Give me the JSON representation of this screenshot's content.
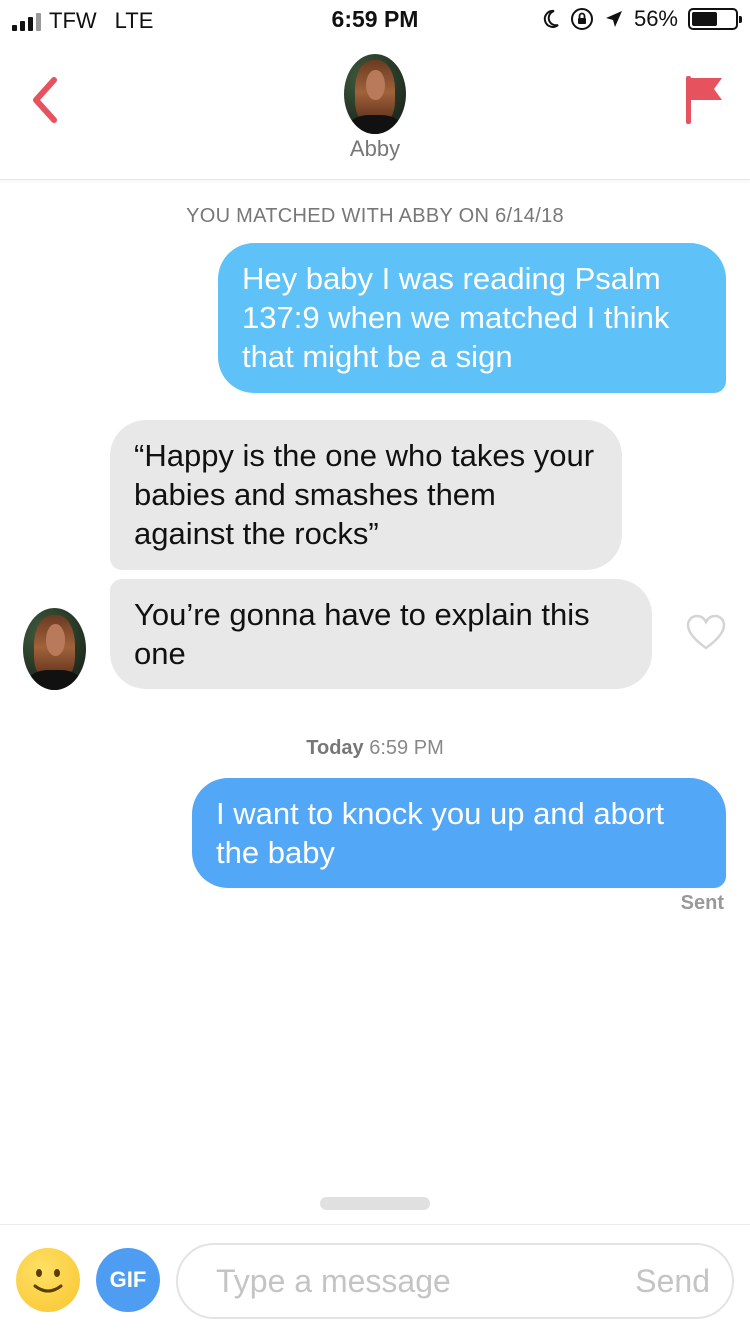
{
  "status_bar": {
    "carrier": "TFW",
    "network": "LTE",
    "time": "6:59 PM",
    "battery": "56%"
  },
  "header": {
    "contact_name": "Abby",
    "accent_color": "#e6535f"
  },
  "conversation": {
    "match_notice": "YOU MATCHED WITH ABBY ON 6/14/18",
    "messages": [
      {
        "direction": "outgoing",
        "text": "Hey baby I was reading Psalm 137:9 when we matched I think that might be a sign"
      },
      {
        "direction": "incoming",
        "text": "“Happy is the one who takes your babies and smashes them against the rocks”"
      },
      {
        "direction": "incoming",
        "text": "You’re gonna have to explain this one"
      },
      {
        "direction": "outgoing",
        "text": "I want to knock you up and abort the baby"
      }
    ],
    "timestamp": {
      "day": "Today",
      "time": "6:59 PM"
    },
    "delivery_status": "Sent"
  },
  "composer": {
    "gif_label": "GIF",
    "placeholder": "Type a message",
    "value": "",
    "send_label": "Send"
  },
  "colors": {
    "outgoing_bubble": "#5ec1f7",
    "outgoing_bubble_latest": "#52a7f6",
    "incoming_bubble": "#e8e8e8",
    "gif_button": "#4f9df3"
  }
}
